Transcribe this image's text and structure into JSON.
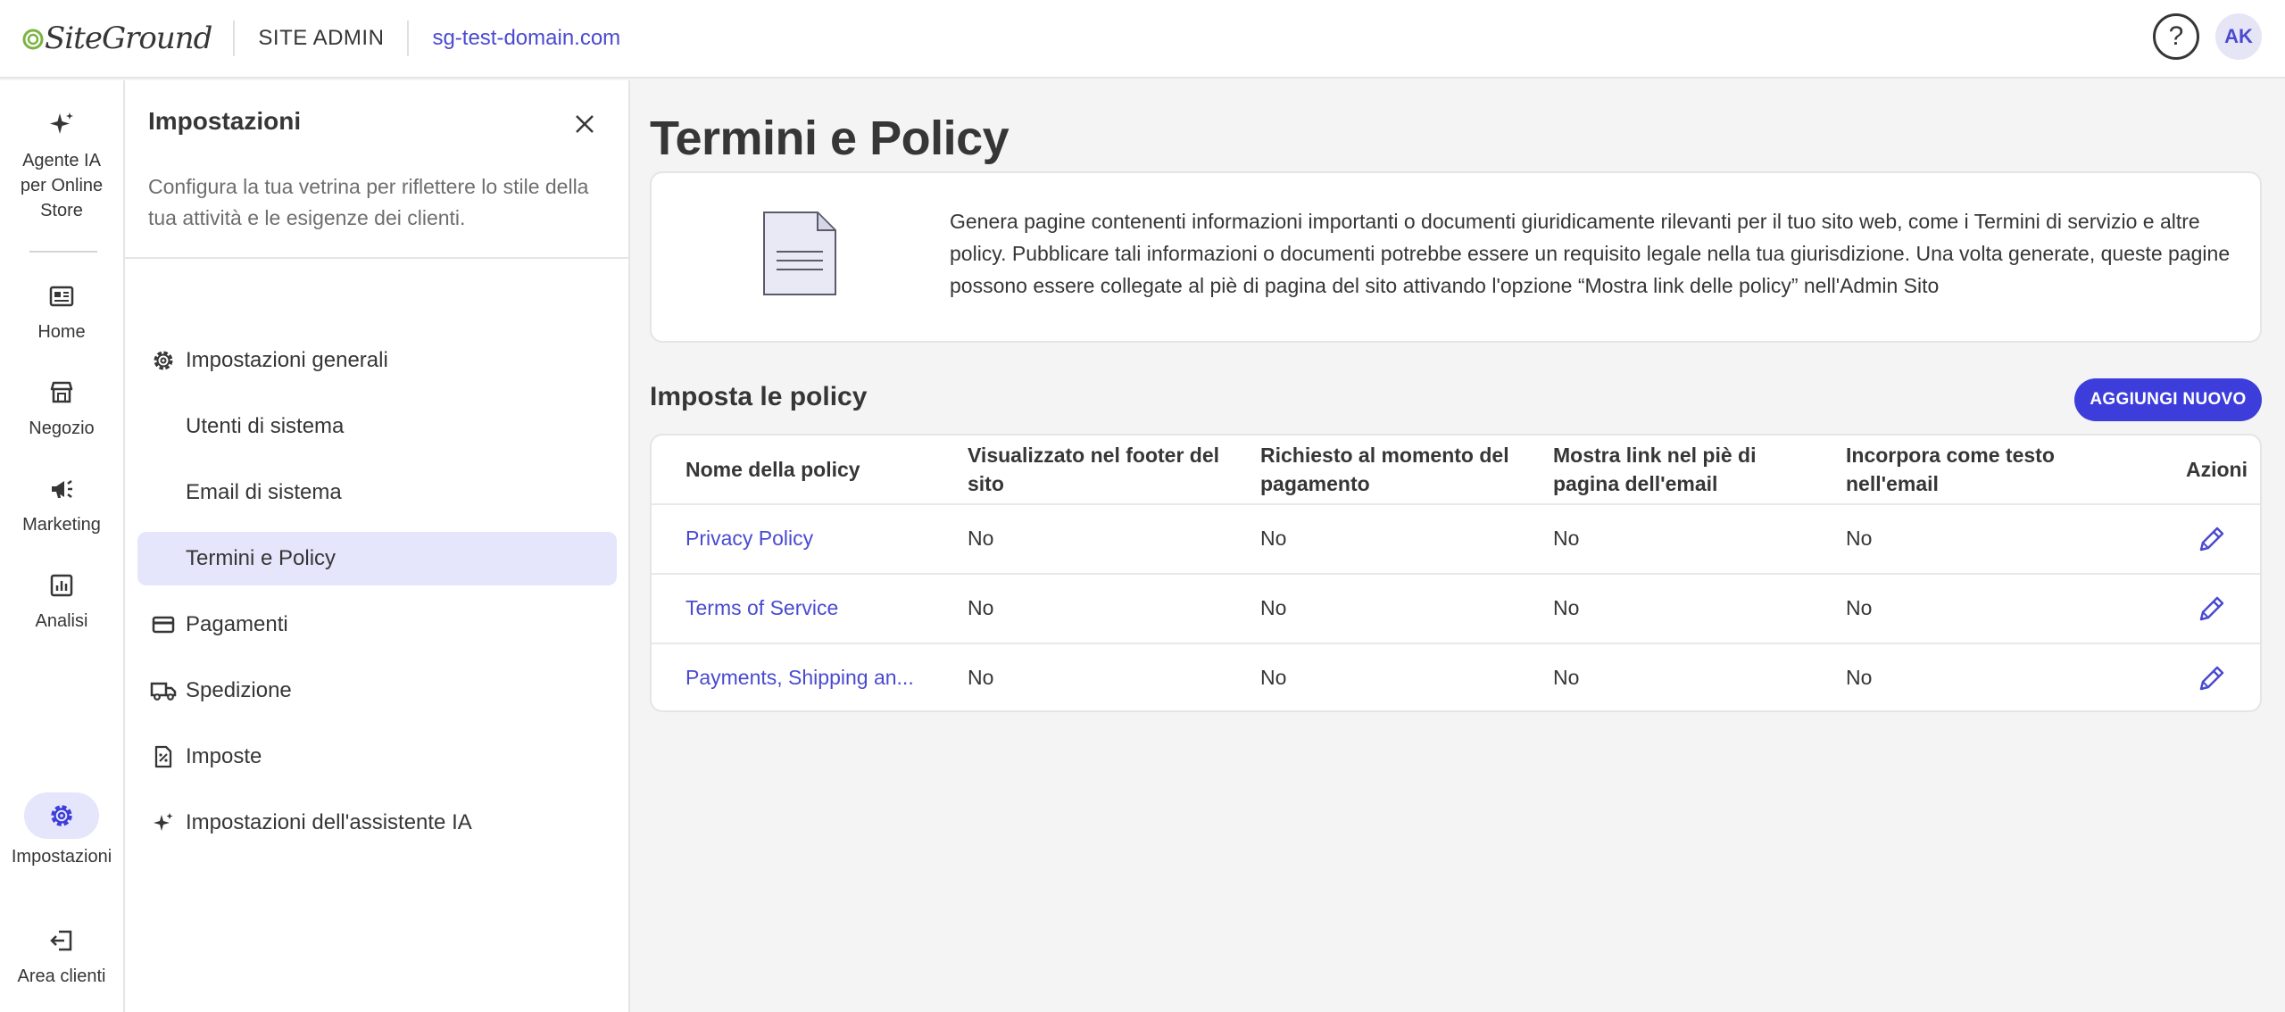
{
  "header": {
    "logo_text": "SiteGround",
    "section": "SITE ADMIN",
    "domain": "sg-test-domain.com",
    "help_label": "?",
    "avatar_initials": "AK"
  },
  "rail": {
    "items": [
      {
        "label": "Agente IA per Online Store",
        "icon": "sparkle-icon"
      },
      {
        "label": "Home",
        "icon": "dashboard-icon"
      },
      {
        "label": "Negozio",
        "icon": "store-icon"
      },
      {
        "label": "Marketing",
        "icon": "megaphone-icon"
      },
      {
        "label": "Analisi",
        "icon": "chart-icon"
      },
      {
        "label": "Impostazioni",
        "icon": "gear-icon"
      },
      {
        "label": "Area clienti",
        "icon": "exit-icon"
      }
    ]
  },
  "settings": {
    "title": "Impostazioni",
    "description": "Configura la tua vetrina per riflettere lo stile della tua attività e le esigenze dei clienti.",
    "menu": [
      {
        "label": "Impostazioni generali",
        "icon": "gear-icon"
      },
      {
        "label": "Utenti di sistema"
      },
      {
        "label": "Email di sistema"
      },
      {
        "label": "Termini e Policy",
        "active": true
      },
      {
        "label": "Pagamenti",
        "icon": "credit-card-icon"
      },
      {
        "label": "Spedizione",
        "icon": "truck-icon"
      },
      {
        "label": "Imposte",
        "icon": "tax-document-icon"
      },
      {
        "label": "Impostazioni dell'assistente IA",
        "icon": "sparkle-icon"
      }
    ]
  },
  "main": {
    "title": "Termini e Policy",
    "info_text": "Genera pagine contenenti informazioni importanti o documenti giuridicamente rilevanti per il tuo sito web, come i Termini di servizio e altre policy. Pubblicare tali informazioni o documenti potrebbe essere un requisito legale nella tua giurisdizione. Una volta generate, queste pagine possono essere collegate al piè di pagina del sito attivando l'opzione “Mostra link delle policy” nell'Admin Sito",
    "section_title": "Imposta le policy",
    "add_button": "AGGIUNGI NUOVO",
    "table": {
      "headers": [
        "Nome della policy",
        "Visualizzato nel footer del sito",
        "Richiesto al momento del pagamento",
        "Mostra link nel piè di pagina dell'email",
        "Incorpora come testo nell'email",
        "Azioni"
      ],
      "rows": [
        {
          "name": "Privacy Policy",
          "footer": "No",
          "checkout": "No",
          "email_link": "No",
          "embed": "No"
        },
        {
          "name": "Terms of Service",
          "footer": "No",
          "checkout": "No",
          "email_link": "No",
          "embed": "No"
        },
        {
          "name": "Payments, Shipping an...",
          "footer": "No",
          "checkout": "No",
          "email_link": "No",
          "embed": "No"
        }
      ]
    }
  },
  "colors": {
    "accent": "#3d3ddb",
    "link": "#4a4ad0",
    "active_bg": "#e5e5fb",
    "logo_green": "#7cb342"
  }
}
